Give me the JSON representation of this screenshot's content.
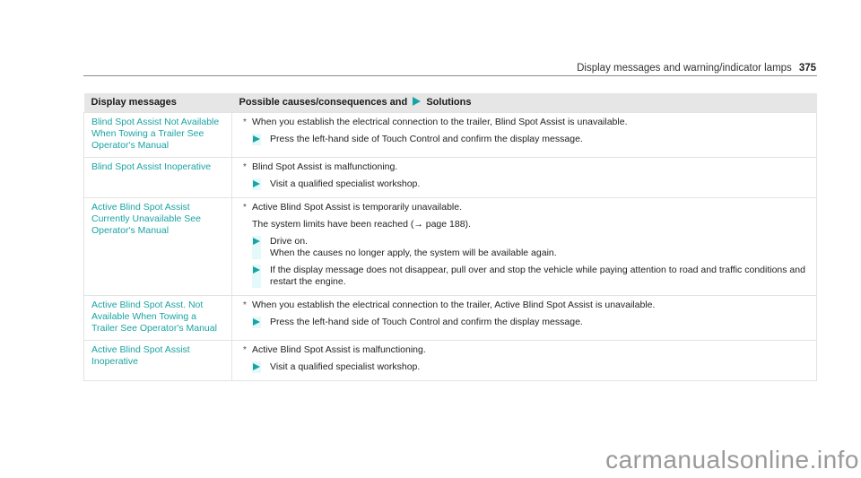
{
  "running_head": {
    "title": "Display messages and warning/indicator lamps",
    "page_number": "375"
  },
  "table": {
    "headers": {
      "col1": "Display messages",
      "col2_prefix": "Possible causes/consequences and",
      "col2_suffix": "Solutions"
    },
    "rows": [
      {
        "message": "Blind Spot Assist Not Available When Towing a Trailer See Operator's Manual",
        "cause": "When you establish the electrical connection to the trailer, Blind Spot Assist is unavailable.",
        "note": "",
        "solutions": [
          "Press the left-hand side of Touch Control and confirm the display message."
        ]
      },
      {
        "message": "Blind Spot Assist Inoperative",
        "cause": "Blind Spot Assist is malfunctioning.",
        "note": "",
        "solutions": [
          "Visit a qualified specialist workshop."
        ]
      },
      {
        "message": "Active Blind Spot Assist Currently Unavailable See Operator's Manual",
        "cause": "Active Blind Spot Assist is temporarily unavailable.",
        "note": "The system limits have been reached (→ page 188).",
        "solutions": [
          "Drive on.\nWhen the causes no longer apply, the system will be available again.",
          "If the display message does not disappear, pull over and stop the vehicle while paying attention to road and traffic conditions and restart the engine."
        ]
      },
      {
        "message": "Active Blind Spot Asst. Not Available When Towing a Trailer See Operator's Manual",
        "cause": "When you establish the electrical connection to the trailer, Active Blind Spot Assist is unavailable.",
        "note": "",
        "solutions": [
          "Press the left-hand side of Touch Control and confirm the display message."
        ]
      },
      {
        "message": "Active Blind Spot Assist Inoperative",
        "cause": "Active Blind Spot Assist is malfunctioning.",
        "note": "",
        "solutions": [
          "Visit a qualified specialist workshop."
        ]
      }
    ]
  },
  "watermark": "carmanualsonline.info",
  "colors": {
    "accent": "#1ba3a3",
    "header_bg": "#e6e6e6"
  }
}
